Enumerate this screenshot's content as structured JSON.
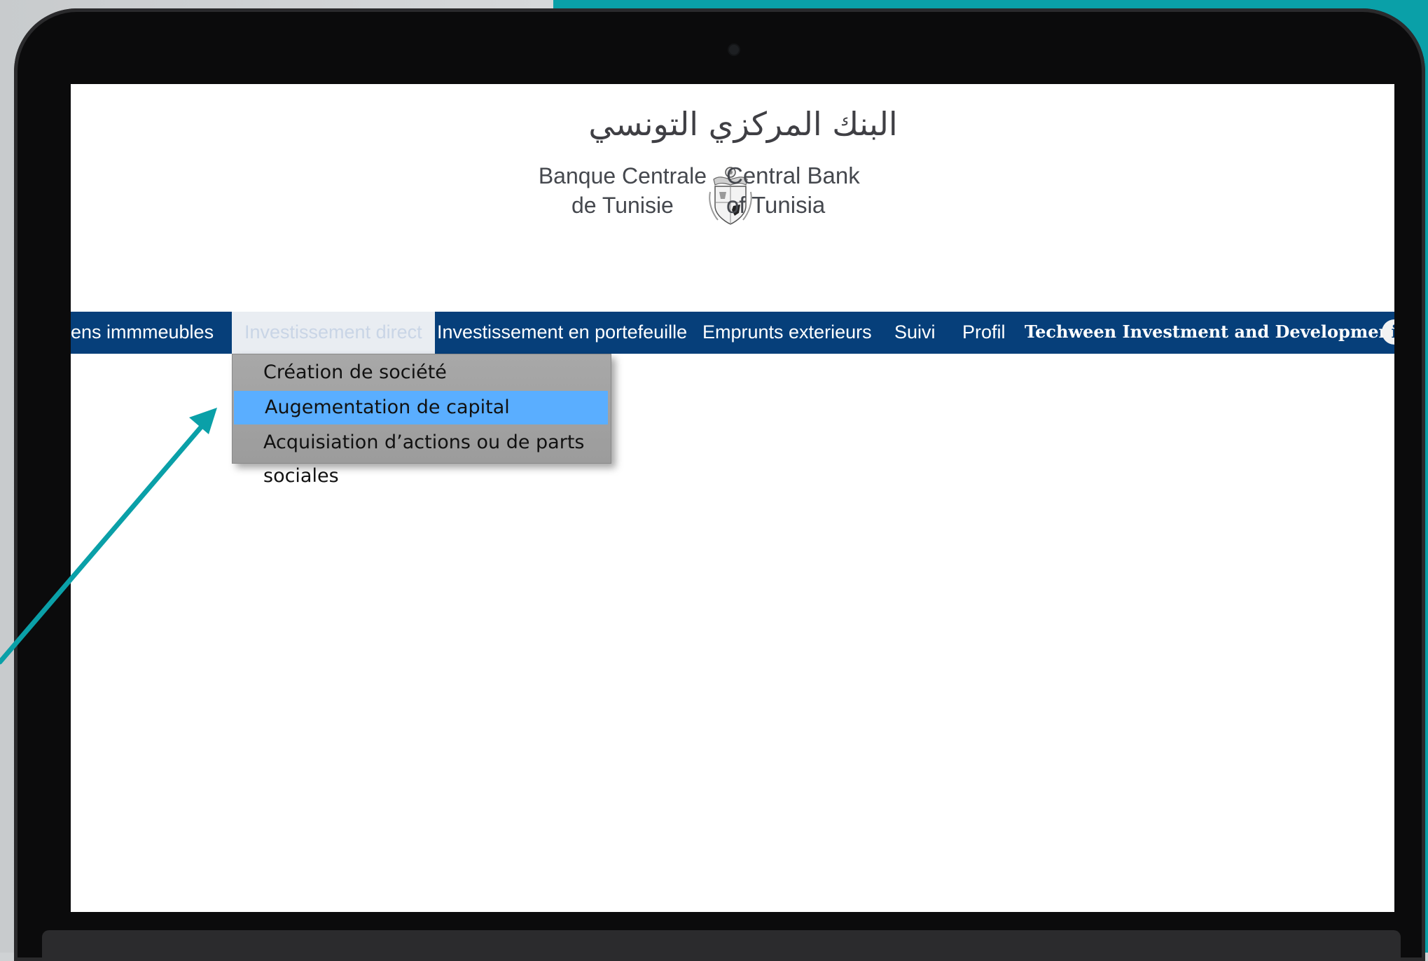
{
  "logo": {
    "arabic": "البنك المركزي التونسي",
    "french": [
      "Banque Centrale",
      "de Tunisie"
    ],
    "english": [
      "Central Bank",
      "of Tunisia"
    ],
    "emblem": "tunisia-coat-of-arms-icon"
  },
  "nav": {
    "items": [
      "ens immmeubles",
      "Investissement direct",
      "Investissement en portefeuille",
      "Emprunts exterieurs",
      "Suivi",
      "Profil",
      "Techween Investment and Development SPC"
    ],
    "active_index": 1,
    "info_icon": "info-icon"
  },
  "dropdown": {
    "items": [
      "Création de société",
      "Augementation de capital",
      "Acquisiation d’actions ou de parts sociales"
    ],
    "highlighted_index": 1
  },
  "colors": {
    "navbar": "#063f7a",
    "highlight": "#5aaeff",
    "accent": "#0aa0a8",
    "dropdown_bg": "#a3a3a3"
  }
}
